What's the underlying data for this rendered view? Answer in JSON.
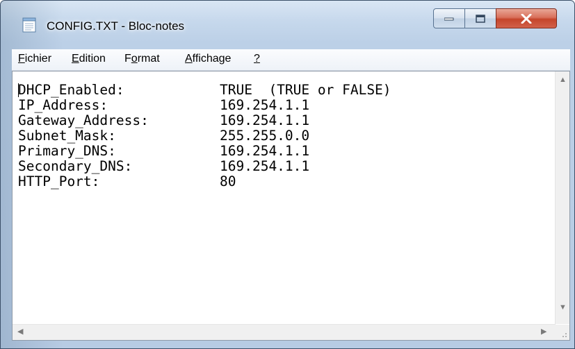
{
  "window": {
    "title": "CONFIG.TXT - Bloc-notes",
    "app_icon": "notepad-icon",
    "controls": {
      "minimize": "minimize-icon",
      "maximize": "maximize-icon",
      "close": "close-icon"
    }
  },
  "menu": {
    "file": {
      "mnemonic": "F",
      "rest": "ichier"
    },
    "edit": {
      "mnemonic": "E",
      "rest": "dition"
    },
    "format": {
      "before": "F",
      "mnemonic": "o",
      "after": "rmat"
    },
    "view": {
      "mnemonic": "A",
      "rest": "ffichage"
    },
    "help": {
      "mnemonic": "?"
    }
  },
  "document": {
    "lines": [
      {
        "key": "DHCP_Enabled:",
        "value": "TRUE  (TRUE or FALSE)"
      },
      {
        "key": "IP_Address:",
        "value": "169.254.1.1"
      },
      {
        "key": "Gateway_Address:",
        "value": "169.254.1.1"
      },
      {
        "key": "Subnet_Mask:",
        "value": "255.255.0.0"
      },
      {
        "key": "Primary_DNS:",
        "value": "169.254.1.1"
      },
      {
        "key": "Secondary_DNS:",
        "value": "169.254.1.1"
      },
      {
        "key": "HTTP_Port:",
        "value": "80"
      }
    ]
  },
  "scrollbars": {
    "up": "scroll-up-arrow-icon",
    "down": "scroll-down-arrow-icon",
    "left": "scroll-left-arrow-icon",
    "right": "scroll-right-arrow-icon"
  }
}
